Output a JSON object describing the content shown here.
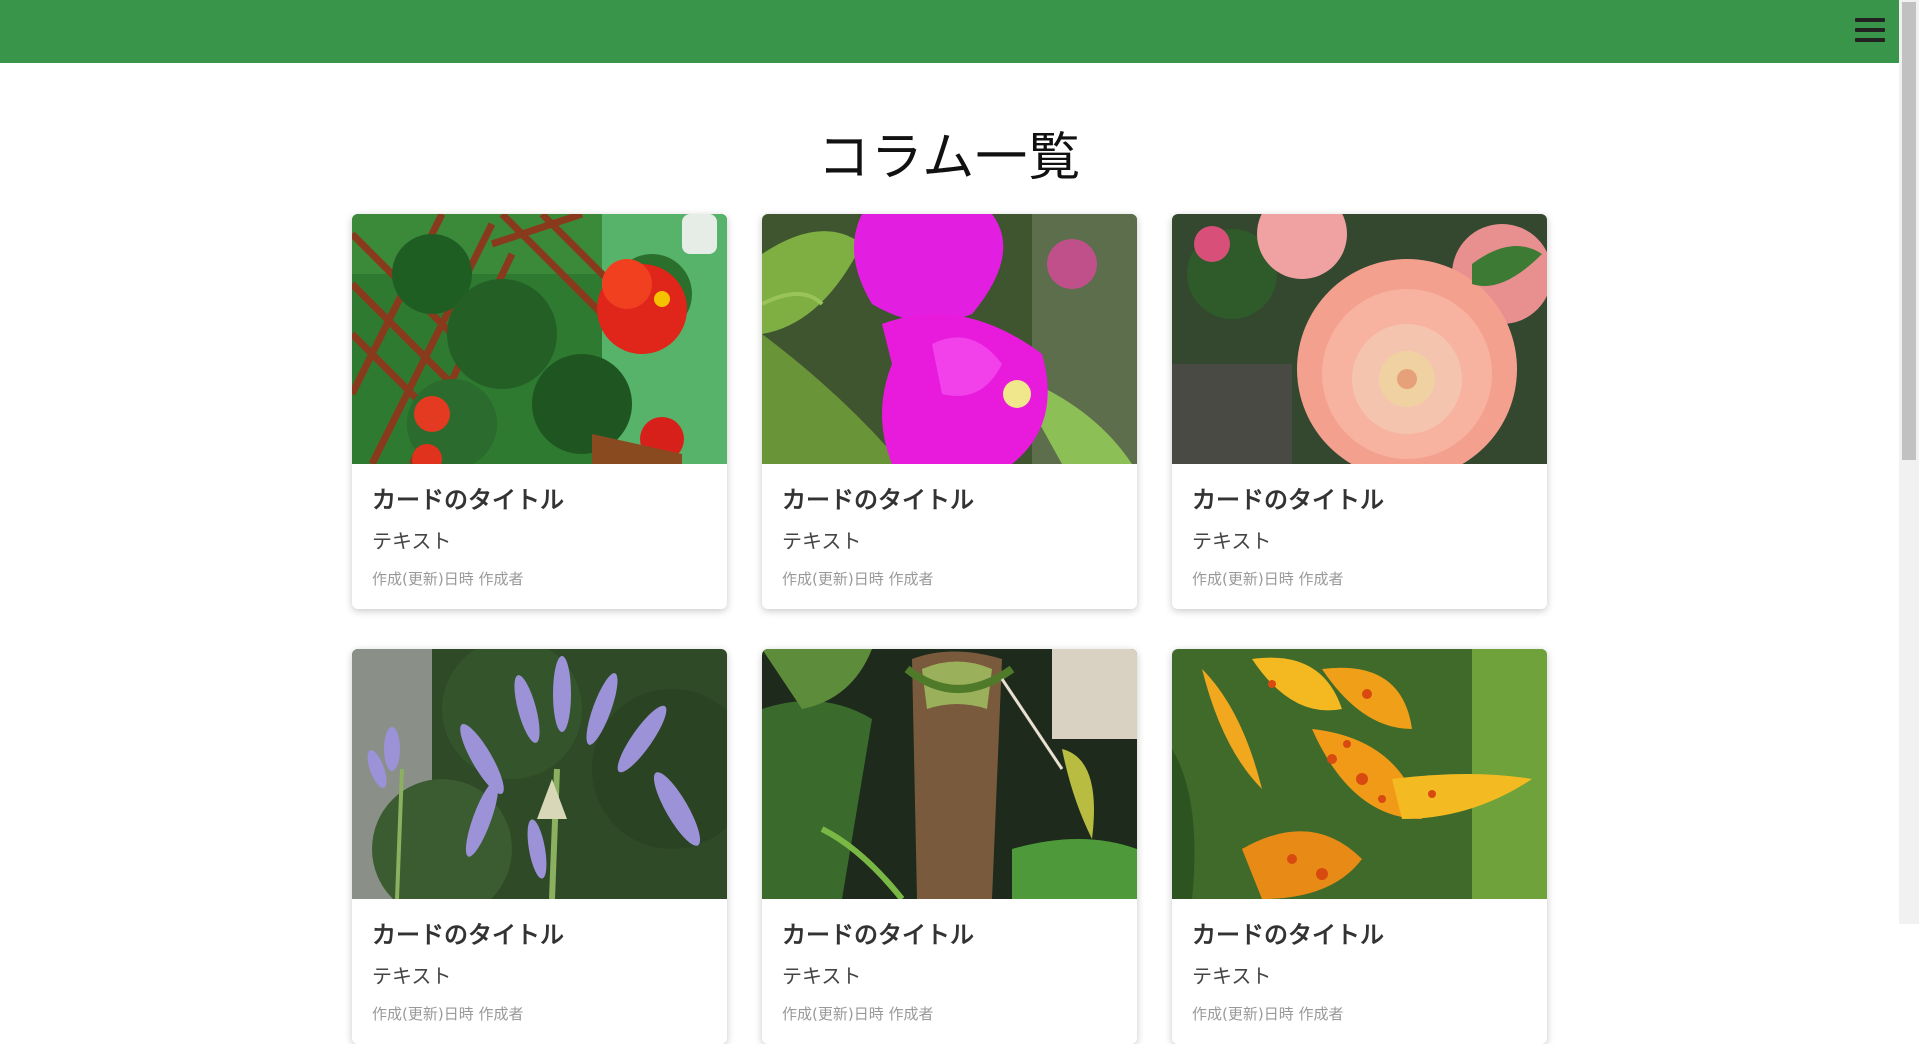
{
  "header": {
    "menu_icon": "hamburger-menu-icon",
    "color": "#38954a"
  },
  "page": {
    "title": "コラム一覧"
  },
  "cards": [
    {
      "title": "カードのタイトル",
      "text": "テキスト",
      "meta": "作成(更新)日時 作成者",
      "image": "red-hibiscus-photo"
    },
    {
      "title": "カードのタイトル",
      "text": "テキスト",
      "meta": "作成(更新)日時 作成者",
      "image": "magenta-bougainvillea-photo"
    },
    {
      "title": "カードのタイトル",
      "text": "テキスト",
      "meta": "作成(更新)日時 作成者",
      "image": "pink-dahlia-photo"
    },
    {
      "title": "カードのタイトル",
      "text": "テキスト",
      "meta": "作成(更新)日時 作成者",
      "image": "purple-agapanthus-photo"
    },
    {
      "title": "カードのタイトル",
      "text": "テキスト",
      "meta": "作成(更新)日時 作成者",
      "image": "pitcher-plant-photo"
    },
    {
      "title": "カードのタイトル",
      "text": "テキスト",
      "meta": "作成(更新)日時 作成者",
      "image": "orange-canna-lily-photo"
    }
  ]
}
